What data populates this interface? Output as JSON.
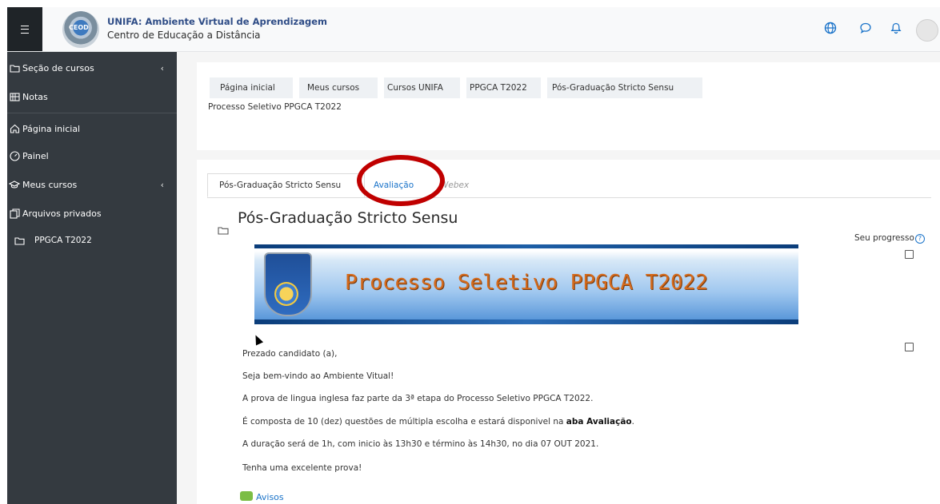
{
  "header": {
    "site_title": "UNIFA: Ambiente Virtual de Aprendizagem",
    "site_subtitle": "Centro de Educação a Distância",
    "logo_text": "CEOD"
  },
  "sidebar": {
    "items": [
      {
        "label": "Seção de cursos",
        "icon": "folder-icon",
        "expandable": true
      },
      {
        "label": "Notas",
        "icon": "grades-icon",
        "expandable": false
      },
      {
        "label": "Página inicial",
        "icon": "home-icon",
        "expandable": false
      },
      {
        "label": "Painel",
        "icon": "dashboard-icon",
        "expandable": false
      },
      {
        "label": "Meus cursos",
        "icon": "graduation-cap-icon",
        "expandable": true
      },
      {
        "label": "Arquivos privados",
        "icon": "files-icon",
        "expandable": false
      },
      {
        "label": "PPGCA T2022",
        "icon": "folder-icon",
        "expandable": false
      }
    ]
  },
  "breadcrumb": {
    "items": [
      "Página inicial",
      "Meus cursos",
      "Cursos UNIFA",
      "PPGCA T2022",
      "Pós-Graduação Stricto Sensu"
    ],
    "current": "Processo Seletivo PPGCA T2022"
  },
  "tabs": [
    {
      "label": "Pós-Graduação Stricto Sensu",
      "active": true
    },
    {
      "label": "Avaliação",
      "active": false
    },
    {
      "label": "Webex",
      "active": false
    }
  ],
  "section": {
    "title": "Pós-Graduação Stricto Sensu",
    "progress_label": "Seu progresso",
    "banner_text": "Processo Seletivo PPGCA T2022",
    "paragraphs": [
      "Prezado candidato (a),",
      "Seja bem-vindo ao Ambiente Vitual!",
      "A prova de lingua inglesa faz parte da 3ª etapa do Processo Seletivo PPGCA T2022.",
      "É composta de 10 (dez) questões de múltipla escolha e estará disponivel na ",
      "A duração será de 1h, com inicio às 13h30 e término  às 14h30, no dia 07 OUT 2021.",
      "Tenha uma excelente prova!"
    ],
    "bold_phrase": "aba Avaliação",
    "bold_suffix": ".",
    "avisos_label": "Avisos"
  },
  "colors": {
    "sidebar_bg": "#343a40",
    "accent": "#1a73c9",
    "highlight": "#c00000"
  }
}
